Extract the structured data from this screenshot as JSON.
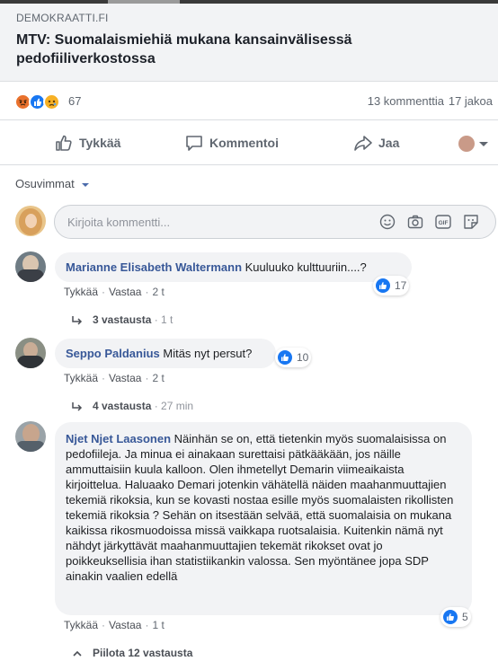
{
  "link": {
    "domain": "DEMOKRAATTI.FI",
    "title": "MTV: Suomalaismiehiä mukana kansainvälisessä pedofiiliverkostossa"
  },
  "stats": {
    "reactions_count": "67",
    "comments": "13 kommenttia",
    "shares": "17 jakoa"
  },
  "actions": {
    "like": "Tykkää",
    "comment": "Kommentoi",
    "share": "Jaa"
  },
  "sort": {
    "label": "Osuvimmat"
  },
  "composer": {
    "placeholder": "Kirjoita kommentti..."
  },
  "comments": [
    {
      "author": "Marianne Elisabeth Waltermann",
      "text": "Kuuluuko kulttuuriin....?",
      "like": "Tykkää",
      "reply": "Vastaa",
      "time": "2 t",
      "reactions": "17",
      "replies_label": "3 vastausta",
      "replies_time": "1 t"
    },
    {
      "author": "Seppo Paldanius",
      "text": "Mitäs nyt persut?",
      "like": "Tykkää",
      "reply": "Vastaa",
      "time": "2 t",
      "reactions": "10",
      "replies_label": "4 vastausta",
      "replies_time": "27 min"
    },
    {
      "author": "Njet Njet Laasonen",
      "text": "Näinhän se on, että tietenkin myös suomalaisissa on pedofiileja. Ja minua ei ainakaan surettaisi pätkääkään, jos näille ammuttaisiin kuula kalloon. Olen ihmetellyt Demarin viimeaikaista kirjoittelua. Haluaako Demari jotenkin vähätellä näiden maahanmuuttajien tekemiä rikoksia, kun se kovasti nostaa esille myös suomalaisten rikollisten tekemiä rikoksia ? Sehän on itsestään selvää, että suomalaisia on mukana kaikissa rikosmuodoissa missä vaikkapa ruotsalaisia. Kuitenkin nämä nyt nähdyt järkyttävät maahanmuuttajien tekemät rikokset ovat jo poikkeuksellisia ihan statistiikankin valossa. Sen myöntänee jopa SDP ainakin vaalien edellä",
      "like": "Tykkää",
      "reply": "Vastaa",
      "time": "1 t",
      "reactions": "5",
      "replies_label": "Piilota 12 vastausta"
    }
  ],
  "colors": {
    "link_blue": "#385898",
    "like_blue": "#1877f2",
    "bubble_bg": "#f2f3f5",
    "meta_gray": "#606770"
  }
}
